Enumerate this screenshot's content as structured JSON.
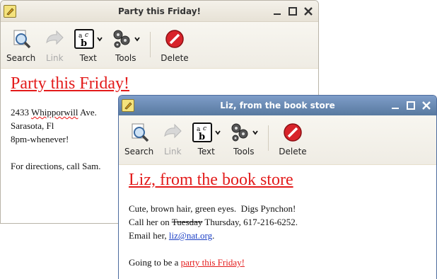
{
  "back_window": {
    "title": "Party this Friday!",
    "toolbar": {
      "search": "Search",
      "link": "Link",
      "text": "Text",
      "tools": "Tools",
      "delete": "Delete"
    },
    "note": {
      "heading": "Party this Friday!",
      "address_line1_rest": " Ave.",
      "address_line1_pre": "2433 ",
      "address_misspelled": "Whipporwill",
      "address_line2": "Sarasota, Fl",
      "address_line3": "8pm-whenever!",
      "directions": "For directions, call Sam."
    }
  },
  "front_window": {
    "title": "Liz, from the book store",
    "toolbar": {
      "search": "Search",
      "link": "Link",
      "text": "Text",
      "tools": "Tools",
      "delete": "Delete"
    },
    "note": {
      "heading": "Liz, from the book store",
      "line1": "Cute, brown hair, green eyes.  Digs Pynchon!",
      "line2_pre": "Call her on ",
      "line2_struck": "Tuesday",
      "line2_post": " Thursday, 617-216-6252.",
      "line3_pre": "Email her, ",
      "line3_email": "liz@nat.org",
      "line3_post": ".",
      "line4_pre": "Going to be a ",
      "line4_link": "party this Friday!"
    }
  },
  "colors": {
    "heading_red": "#e31b1b",
    "email_blue": "#1a3ec5",
    "active_titlebar": "#6a89b4"
  },
  "icons": [
    "note-icon",
    "minimize-icon",
    "maximize-icon",
    "close-icon",
    "search-icon",
    "link-icon",
    "text-icon",
    "tools-icon",
    "delete-icon",
    "chevron-down-icon"
  ]
}
